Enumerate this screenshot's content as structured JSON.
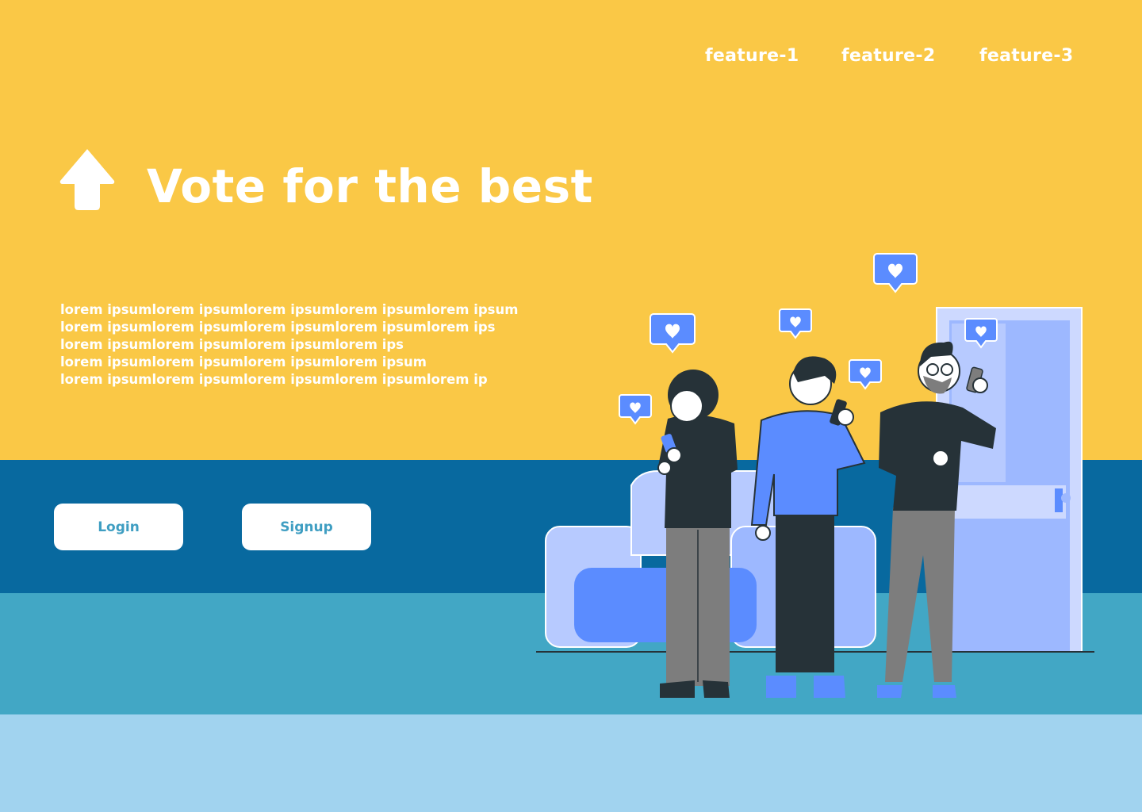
{
  "nav": {
    "items": [
      {
        "label": "feature-1"
      },
      {
        "label": "feature-2"
      },
      {
        "label": "feature-3"
      }
    ]
  },
  "hero": {
    "icon": "arrow-up-icon",
    "title": "Vote for the best",
    "description_lines": [
      "lorem ipsumlorem ipsumlorem ipsumlorem ipsumlorem ipsum",
      "lorem ipsumlorem ipsumlorem ipsumlorem ipsumlorem ips",
      "lorem ipsumlorem ipsumlorem ipsumlorem ips",
      "lorem ipsumlorem ipsumlorem ipsumlorem ipsum",
      "lorem ipsumlorem ipsumlorem ipsumlorem ipsumlorem ip"
    ]
  },
  "auth": {
    "login_label": "Login",
    "signup_label": "Signup"
  },
  "illustration": {
    "subject": "people-with-phones-and-like-icons",
    "icons": [
      "heart-bubble-icon",
      "sofa",
      "door"
    ]
  },
  "colors": {
    "yellow": "#fac846",
    "navy": "#08699f",
    "teal": "#42a7c5",
    "light_blue": "#a1d3ef",
    "accent_blue": "#5b8cff",
    "button_text": "#3f9ec2"
  }
}
